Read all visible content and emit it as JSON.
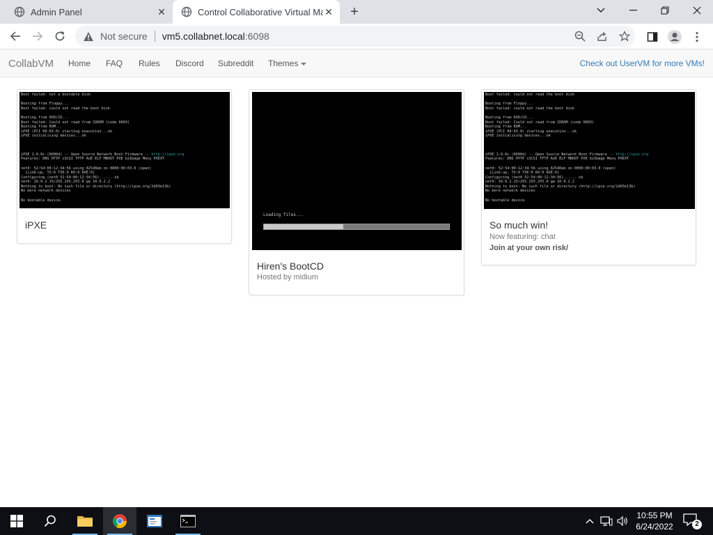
{
  "browser": {
    "tabs": [
      {
        "title": "Admin Panel",
        "active": false
      },
      {
        "title": "Control Collaborative Virtual Ma",
        "active": true
      }
    ],
    "omnibox": {
      "security_label": "Not secure",
      "host": "vm5.collabnet.local",
      "port": ":6098"
    }
  },
  "site_nav": {
    "brand": "CollabVM",
    "links": [
      "Home",
      "FAQ",
      "Rules",
      "Discord",
      "Subreddit",
      "Themes"
    ],
    "right_link": "Check out UserVM for more VMs!"
  },
  "vms": [
    {
      "name": "iPXE",
      "terminal": [
        "Boot failed: not a bootable disk",
        "",
        "Booting from Floppy...",
        "Boot failed: could not read the boot disk",
        "",
        "Booting from DVD/CD...",
        "Boot failed: Could not read from CDROM (code 0003)",
        "Booting from ROM...",
        "iPXE (PCI 00:03.0) starting execution...ok",
        "iPXE initialising devices...ok",
        "",
        "",
        "",
        "iPXE 1.0.0+ (6600d) -- Open Source Network Boot Firmware -- http://ipxe.org",
        "Features: DNS HTTP iSCSI TFTP AoE ELF MBOOT PXE bzImage Menu PXEXT",
        "",
        "net0: 52:54:00:12:34:56 using 82540em on 0000:00:03.0 (open)",
        "  [Link:up, TX:0 TXE:0 RX:0 RXE:0]",
        "Configuring (net0 52:54:00:12:34:56)...... ok",
        "net0: 10.0.2.15/255.255.255.0 gw 10.0.2.2",
        "Nothing to boot: No such file or directory (http://ipxe.org/2d03e13b)",
        "No more network devices",
        "",
        "No bootable device."
      ]
    },
    {
      "name": "Hiren's BootCD",
      "subtitle": "Hosted by midium",
      "loading_text": "Loading files...",
      "progress": 0.43
    },
    {
      "name": "So much win!",
      "subtitle": "Now featuring: chat",
      "subtitle2": "Join at your own risk/",
      "terminal": [
        "Boot failed: could not read the boot disk",
        "",
        "Booting from Floppy...",
        "Boot failed: could not read the boot disk",
        "",
        "Booting from DVD/CD...",
        "Boot failed: Could not read from CDROM (code 0003)",
        "Booting from ROM...",
        "iPXE (PCI 00:03.0) starting execution...ok",
        "iPXE initialising devices...ok",
        "",
        "",
        "",
        "iPXE 1.0.0+ (6600d) -- Open Source Network Boot Firmware -- http://ipxe.org",
        "Features: DNS HTTP iSCSI TFTP AoE ELF MBOOT PXE bzImage Menu PXEXT",
        "",
        "net0: 52:54:00:12:34:56 using 82540em on 0000:00:03.0 (open)",
        "  [Link:up, TX:0 TXE:0 RX:0 RXE:0]",
        "Configuring (net0 52:54:00:12:34:56)...... ok",
        "net0: 10.0.2.15/255.255.255.0 gw 10.0.2.2",
        "Nothing to boot: No such file or directory (http://ipxe.org/2d03e13b)",
        "No more network devices",
        "",
        "No bootable device."
      ]
    }
  ],
  "taskbar": {
    "time": "10:55 PM",
    "date": "6/24/2022",
    "notification_count": "2",
    "accent_color": "#76b9ed"
  }
}
